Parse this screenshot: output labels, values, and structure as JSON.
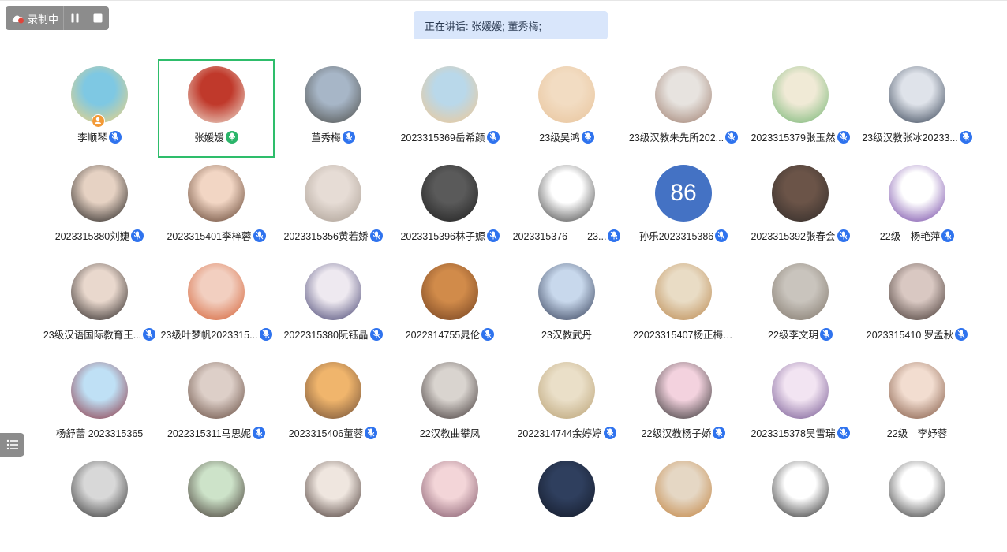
{
  "recording": {
    "status_label": "录制中",
    "pause_icon": "pause-icon",
    "stop_icon": "stop-icon"
  },
  "speaking_banner": {
    "text": "正在讲话: 张媛媛; 董秀梅;"
  },
  "colors": {
    "active_border": "#2ebd6b",
    "mic_muted": "#2f73ee",
    "mic_speaking": "#2bb56a",
    "banner_bg": "#d9e6fb",
    "toolbar_bg": "#8c8c8c",
    "badge": "#f39a37"
  },
  "participants": [
    {
      "name": "李顺琴",
      "mic": "muted",
      "host_badge": true,
      "avatar": {
        "type": "photo",
        "colors": [
          "#7ec8e3",
          "#f5d37a"
        ]
      }
    },
    {
      "name": "张媛媛",
      "mic": "speaking",
      "active": true,
      "avatar": {
        "type": "photo",
        "colors": [
          "#c0392b",
          "#f0e6d8"
        ]
      }
    },
    {
      "name": "董秀梅",
      "mic": "muted",
      "avatar": {
        "type": "photo",
        "colors": [
          "#a7b6c7",
          "#4a4a45"
        ]
      }
    },
    {
      "name": "2023315369岳希颜",
      "mic": "muted",
      "avatar": {
        "type": "photo",
        "colors": [
          "#b9d8ea",
          "#f3c78f"
        ]
      }
    },
    {
      "name": "23级吴鸿",
      "mic": "muted",
      "avatar": {
        "type": "photo",
        "colors": [
          "#f2dcc2",
          "#e8c39a"
        ]
      }
    },
    {
      "name": "23级汉教朱先所202...",
      "mic": "muted",
      "avatar": {
        "type": "photo",
        "colors": [
          "#e7e3df",
          "#9c7a6a"
        ]
      }
    },
    {
      "name": "2023315379张玉然",
      "mic": "muted",
      "avatar": {
        "type": "photo",
        "colors": [
          "#f0ead6",
          "#6fb36f"
        ]
      }
    },
    {
      "name": "23级汉教张冰20233...",
      "mic": "muted",
      "avatar": {
        "type": "photo",
        "colors": [
          "#dfe3ea",
          "#2d3a4d"
        ]
      }
    },
    {
      "name": "2023315380刘婕",
      "mic": "muted",
      "avatar": {
        "type": "photo",
        "colors": [
          "#e6d2c3",
          "#1c1a1a"
        ]
      }
    },
    {
      "name": "2023315401李梓蓉",
      "mic": "muted",
      "avatar": {
        "type": "photo",
        "colors": [
          "#f2d6c4",
          "#5b3b2a"
        ]
      }
    },
    {
      "name": "2023315356黄若娇",
      "mic": "muted",
      "avatar": {
        "type": "photo",
        "colors": [
          "#e6dcd5",
          "#a79b90"
        ]
      }
    },
    {
      "name": "2023315396林子嫄",
      "mic": "muted",
      "avatar": {
        "type": "photo",
        "colors": [
          "#5a5a5a",
          "#1d1d1d"
        ]
      }
    },
    {
      "name": "2023315376　　23...",
      "mic": "muted",
      "avatar": {
        "type": "photo",
        "colors": [
          "#ffffff",
          "#3a3a3a"
        ]
      }
    },
    {
      "name": "孙乐2023315386",
      "mic": "muted",
      "avatar": {
        "type": "number",
        "text": "86",
        "colors": [
          "#4472c4",
          "#4472c4"
        ]
      }
    },
    {
      "name": "2023315392张春会",
      "mic": "muted",
      "avatar": {
        "type": "photo",
        "colors": [
          "#6b5448",
          "#2f2a28"
        ]
      }
    },
    {
      "name": "22级　杨艳萍",
      "mic": "muted",
      "avatar": {
        "type": "photo",
        "colors": [
          "#ffffff",
          "#6a3aa0"
        ]
      }
    },
    {
      "name": "23级汉语国际教育王...",
      "mic": "muted",
      "avatar": {
        "type": "photo",
        "colors": [
          "#e9d8cd",
          "#1f1a1a"
        ]
      }
    },
    {
      "name": "23级叶梦帆2023315...",
      "mic": "muted",
      "avatar": {
        "type": "photo",
        "colors": [
          "#f2cfc0",
          "#d35b2e"
        ]
      }
    },
    {
      "name": "2022315380阮钰晶",
      "mic": "muted",
      "avatar": {
        "type": "photo",
        "colors": [
          "#eee9f0",
          "#3d3a6b"
        ]
      }
    },
    {
      "name": "2022314755晁伦",
      "mic": "muted",
      "avatar": {
        "type": "photo",
        "colors": [
          "#d18b4a",
          "#6e3d1e"
        ]
      }
    },
    {
      "name": "23汉教武丹",
      "mic": "none",
      "avatar": {
        "type": "photo",
        "colors": [
          "#c8d8ec",
          "#2c3650"
        ]
      }
    },
    {
      "name": "22023315407杨正梅23...",
      "mic": "none",
      "avatar": {
        "type": "photo",
        "colors": [
          "#e9dcc5",
          "#b9854a"
        ]
      }
    },
    {
      "name": "22级李文玥",
      "mic": "muted",
      "avatar": {
        "type": "photo",
        "colors": [
          "#c9c4bd",
          "#7d7367"
        ]
      }
    },
    {
      "name": "2023315410 罗孟秋",
      "mic": "muted",
      "avatar": {
        "type": "photo",
        "colors": [
          "#d9c8c2",
          "#3b2e2a"
        ]
      }
    },
    {
      "name": "杨舒蕾 2023315365",
      "mic": "none",
      "avatar": {
        "type": "photo",
        "colors": [
          "#bfe0f5",
          "#8a2d3b"
        ]
      }
    },
    {
      "name": "2022315311马思妮",
      "mic": "muted",
      "avatar": {
        "type": "photo",
        "colors": [
          "#ddcfc8",
          "#5f4438"
        ]
      }
    },
    {
      "name": "2023315406董蓉",
      "mic": "muted",
      "avatar": {
        "type": "photo",
        "colors": [
          "#f0b56c",
          "#6b4a34"
        ]
      }
    },
    {
      "name": "22汉教曲攀凤",
      "mic": "none",
      "avatar": {
        "type": "photo",
        "colors": [
          "#d9d4cf",
          "#3a3030"
        ]
      }
    },
    {
      "name": "2022314744余婷婷",
      "mic": "muted",
      "avatar": {
        "type": "photo",
        "colors": [
          "#eadfc8",
          "#b79e70"
        ]
      }
    },
    {
      "name": "22级汉教杨子娇",
      "mic": "muted",
      "avatar": {
        "type": "photo",
        "colors": [
          "#f3d2de",
          "#2b2b2b"
        ]
      }
    },
    {
      "name": "2023315378吴雪瑞",
      "mic": "muted",
      "avatar": {
        "type": "photo",
        "colors": [
          "#f2e4f2",
          "#6e4f8c"
        ]
      }
    },
    {
      "name": "22级　李妤蓉",
      "mic": "none",
      "avatar": {
        "type": "photo",
        "colors": [
          "#f2ddd0",
          "#7a4f3a"
        ]
      }
    },
    {
      "name": "",
      "mic": "none",
      "avatar": {
        "type": "photo",
        "colors": [
          "#d8d8d8",
          "#2b2b2b"
        ]
      }
    },
    {
      "name": "",
      "mic": "none",
      "avatar": {
        "type": "photo",
        "colors": [
          "#cde3c9",
          "#3b2f2a"
        ]
      }
    },
    {
      "name": "",
      "mic": "none",
      "avatar": {
        "type": "photo",
        "colors": [
          "#efe6df",
          "#3e2e2a"
        ]
      }
    },
    {
      "name": "",
      "mic": "none",
      "avatar": {
        "type": "photo",
        "colors": [
          "#f3d5d8",
          "#7a4f63"
        ]
      }
    },
    {
      "name": "",
      "mic": "none",
      "avatar": {
        "type": "photo",
        "colors": [
          "#2f3f5e",
          "#121826"
        ]
      }
    },
    {
      "name": "",
      "mic": "none",
      "avatar": {
        "type": "photo",
        "colors": [
          "#e5d7c4",
          "#c07f3a"
        ]
      }
    },
    {
      "name": "",
      "mic": "none",
      "avatar": {
        "type": "photo",
        "colors": [
          "#ffffff",
          "#1f1f1f"
        ]
      }
    },
    {
      "name": "",
      "mic": "none",
      "avatar": {
        "type": "photo",
        "colors": [
          "#ffffff",
          "#2a2a2a"
        ]
      }
    }
  ],
  "side_panel_toggle": {
    "icon": "list-icon"
  }
}
